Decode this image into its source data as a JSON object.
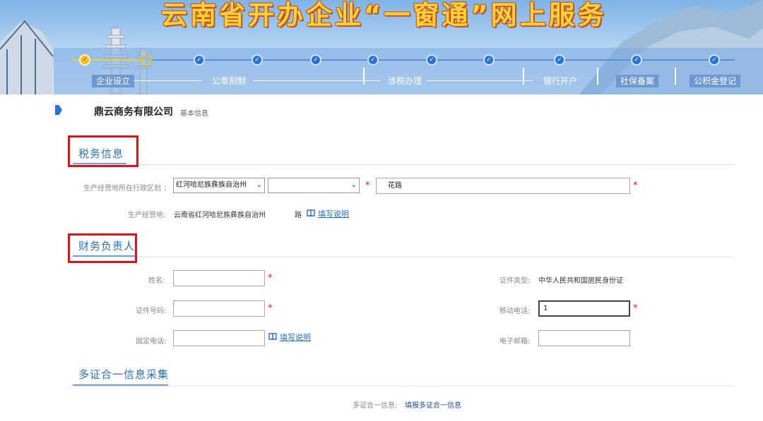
{
  "banner": {
    "title": "云南省开办企业“一窗通”网上服务"
  },
  "steps": [
    {
      "label": "企业设立",
      "state": "current"
    },
    {
      "label": "公章刻制",
      "state": "done"
    },
    {
      "label": "涉税办理",
      "state": "done"
    },
    {
      "label": "银行开户",
      "state": "done"
    },
    {
      "label": "社保备案",
      "state": "done"
    },
    {
      "label": "公积金登记",
      "state": "done"
    }
  ],
  "company": {
    "name": "鼎云商务有限公司",
    "subtitle": "基本信息"
  },
  "tax_section": {
    "title": "税务信息",
    "region_label": "生产经营地所在行政区划 ：",
    "region_select_1": "红河哈尼族彝族自治州",
    "region_select_2": "",
    "street_value": "花路",
    "address_label": "生产经营地:",
    "address_value": "云南省红河哈尼族彝族自治州",
    "address_suffix": "路",
    "help_link": "填写说明"
  },
  "finance_section": {
    "title": "财务负责人",
    "name_label": "姓名:",
    "name_value": "",
    "id_type_label": "证件类型:",
    "id_type_value": "中华人民共和国居民身份证",
    "id_number_label": "证件号码:",
    "id_number_value": "",
    "mobile_label": "移动电话:",
    "mobile_value": "1",
    "phone_label": "固定电话:",
    "phone_value": "",
    "phone_help_link": "填写说明",
    "email_label": "电子邮箱:",
    "email_value": ""
  },
  "multi_cert_section": {
    "title": "多证合一信息采集",
    "label": "多证合一信息:",
    "link": "填报多证合一信息"
  },
  "colors": {
    "accent_blue": "#2a6fc9",
    "required_red": "#e0141b",
    "highlight_red": "#d9141b",
    "banner_title_yellow": "#ffd23a"
  }
}
